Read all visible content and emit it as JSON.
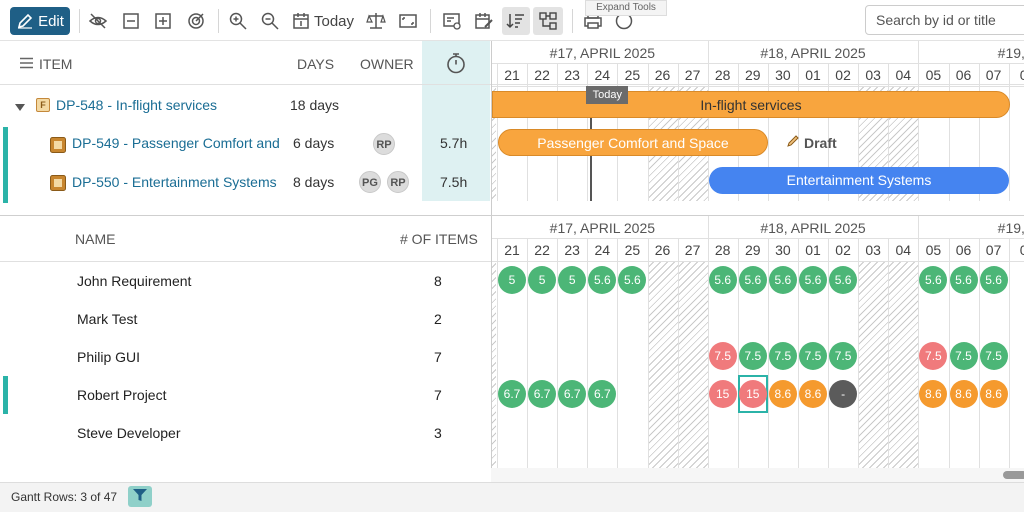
{
  "toolbar": {
    "edit_label": "Edit",
    "today_label": "Today",
    "tooltip": "Expand Tools",
    "search_placeholder": "Search by id or title"
  },
  "gantt": {
    "columns": {
      "item": "ITEM",
      "days": "DAYS",
      "owner": "OWNER"
    },
    "weeks": [
      "#17, APRIL 2025",
      "#18, APRIL 2025",
      "#19, MA"
    ],
    "days": [
      "21",
      "22",
      "23",
      "24",
      "25",
      "26",
      "27",
      "28",
      "29",
      "30",
      "01",
      "02",
      "03",
      "04",
      "05",
      "06",
      "07",
      "0"
    ],
    "today_label": "Today",
    "rows": [
      {
        "id": "DP-548 - In-flight services",
        "days": "18 days",
        "owners": [],
        "hours": "",
        "bar": "In-flight services"
      },
      {
        "id": "DP-549 - Passenger Comfort and",
        "days": "6 days",
        "owners": [
          "RP"
        ],
        "hours": "5.7h",
        "bar": "Passenger Comfort and Space",
        "note": "Draft"
      },
      {
        "id": "DP-550 - Entertainment Systems",
        "days": "8 days",
        "owners": [
          "PG",
          "RP"
        ],
        "hours": "7.5h",
        "bar": "Entertainment Systems"
      }
    ],
    "type_badge": "F"
  },
  "resources": {
    "columns": {
      "name": "NAME",
      "count": "# OF ITEMS"
    },
    "rows": [
      {
        "name": "John Requirement",
        "count": "8",
        "cells": [
          {
            "d": 0,
            "v": "5",
            "c": "green"
          },
          {
            "d": 1,
            "v": "5",
            "c": "green"
          },
          {
            "d": 2,
            "v": "5",
            "c": "green"
          },
          {
            "d": 3,
            "v": "5.6",
            "c": "green"
          },
          {
            "d": 4,
            "v": "5.6",
            "c": "green"
          },
          {
            "d": 7,
            "v": "5.6",
            "c": "green"
          },
          {
            "d": 8,
            "v": "5.6",
            "c": "green"
          },
          {
            "d": 9,
            "v": "5.6",
            "c": "green"
          },
          {
            "d": 10,
            "v": "5.6",
            "c": "green"
          },
          {
            "d": 11,
            "v": "5.6",
            "c": "green"
          },
          {
            "d": 14,
            "v": "5.6",
            "c": "green"
          },
          {
            "d": 15,
            "v": "5.6",
            "c": "green"
          },
          {
            "d": 16,
            "v": "5.6",
            "c": "green"
          }
        ]
      },
      {
        "name": "Mark Test",
        "count": "2",
        "cells": []
      },
      {
        "name": "Philip GUI",
        "count": "7",
        "cells": [
          {
            "d": 7,
            "v": "7.5",
            "c": "red"
          },
          {
            "d": 8,
            "v": "7.5",
            "c": "green"
          },
          {
            "d": 9,
            "v": "7.5",
            "c": "green"
          },
          {
            "d": 10,
            "v": "7.5",
            "c": "green"
          },
          {
            "d": 11,
            "v": "7.5",
            "c": "green"
          },
          {
            "d": 14,
            "v": "7.5",
            "c": "red"
          },
          {
            "d": 15,
            "v": "7.5",
            "c": "green"
          },
          {
            "d": 16,
            "v": "7.5",
            "c": "green"
          }
        ]
      },
      {
        "name": "Robert Project",
        "count": "7",
        "cells": [
          {
            "d": 0,
            "v": "6.7",
            "c": "green"
          },
          {
            "d": 1,
            "v": "6.7",
            "c": "green"
          },
          {
            "d": 2,
            "v": "6.7",
            "c": "green"
          },
          {
            "d": 3,
            "v": "6.7",
            "c": "green"
          },
          {
            "d": 7,
            "v": "15",
            "c": "red"
          },
          {
            "d": 8,
            "v": "15",
            "c": "red",
            "selected": true
          },
          {
            "d": 9,
            "v": "8.6",
            "c": "orange"
          },
          {
            "d": 10,
            "v": "8.6",
            "c": "orange"
          },
          {
            "d": 11,
            "v": "-",
            "c": "gray"
          },
          {
            "d": 14,
            "v": "8.6",
            "c": "orange"
          },
          {
            "d": 15,
            "v": "8.6",
            "c": "orange"
          },
          {
            "d": 16,
            "v": "8.6",
            "c": "orange"
          }
        ]
      },
      {
        "name": "Steve Developer",
        "count": "3",
        "cells": []
      }
    ]
  },
  "footer": {
    "rows_label": "Gantt Rows: 3 of 47"
  },
  "colors": {
    "accent": "#1f5f86",
    "teal": "#2bb3a8",
    "orange": "#f8a53e",
    "blue": "#4584f0",
    "green": "#4cb677",
    "red": "#f07a7c"
  }
}
